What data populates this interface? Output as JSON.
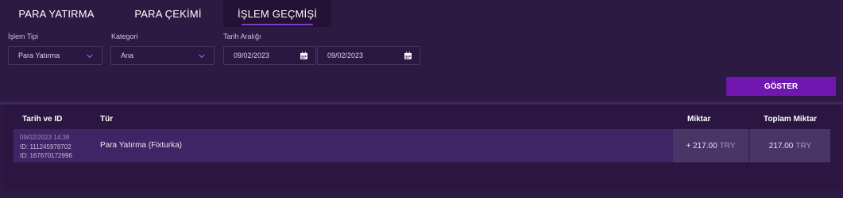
{
  "tabs": [
    {
      "label": "PARA YATIRMA"
    },
    {
      "label": "PARA ÇEKİMİ"
    },
    {
      "label": "İŞLEM GEÇMİŞİ"
    }
  ],
  "filters": {
    "type_label": "İşlem Tipi",
    "type_value": "Para Yatırma",
    "category_label": "Kategori",
    "category_value": "Ana",
    "date_label": "Tarih Aralığı",
    "date_from": "09/02/2023",
    "date_to": "09/02/2023"
  },
  "show_button": "GÖSTER",
  "table": {
    "headers": {
      "date_id": "Tarih ve ID",
      "type": "Tür",
      "amount": "Miktar",
      "total": "Toplam Miktar"
    },
    "rows": [
      {
        "datetime": "09/02/2023 14:38",
        "id1": "ID: 111245978702",
        "id2": "ID: 167670172996",
        "type": "Para Yatırma (Fixturka)",
        "amount": "+ 217.00",
        "amount_currency": "TRY",
        "total": "217.00",
        "total_currency": "TRY"
      }
    ]
  },
  "colors": {
    "background": "#2d1a42",
    "accent": "#7017b0",
    "row": "#3f2466"
  },
  "icons": {
    "dropdown": "chevron-down-icon",
    "date": "calendar-icon"
  }
}
